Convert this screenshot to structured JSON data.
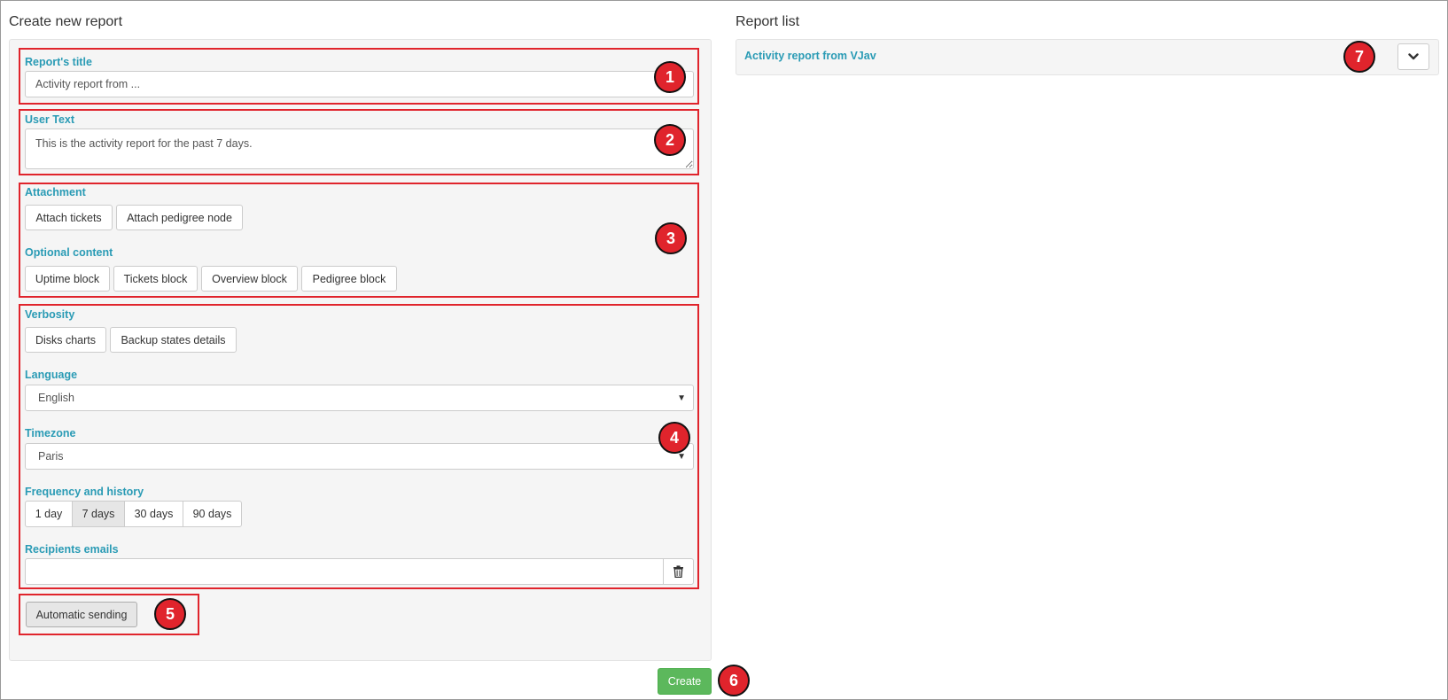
{
  "left_panel": {
    "heading": "Create new report",
    "report_title": {
      "label": "Report's title",
      "value": "Activity report from ..."
    },
    "user_text": {
      "label": "User Text",
      "value": "This is the activity report for the past 7 days."
    },
    "attachment": {
      "label": "Attachment",
      "buttons": [
        "Attach tickets",
        "Attach pedigree node"
      ]
    },
    "optional_content": {
      "label": "Optional content",
      "buttons": [
        "Uptime block",
        "Tickets block",
        "Overview block",
        "Pedigree block"
      ]
    },
    "verbosity": {
      "label": "Verbosity",
      "buttons": [
        "Disks charts",
        "Backup states details"
      ]
    },
    "language": {
      "label": "Language",
      "selected": "English"
    },
    "timezone": {
      "label": "Timezone",
      "selected": "Paris"
    },
    "frequency": {
      "label": "Frequency and history",
      "options": [
        "1 day",
        "7 days",
        "30 days",
        "90 days"
      ],
      "active": "7 days"
    },
    "recipients": {
      "label": "Recipients emails",
      "value": ""
    },
    "automatic_sending": {
      "label": "Automatic sending"
    }
  },
  "create_button": {
    "label": "Create"
  },
  "right_panel": {
    "heading": "Report list",
    "items": [
      {
        "title": "Activity report from VJav"
      }
    ]
  },
  "badges": [
    "1",
    "2",
    "3",
    "4",
    "5",
    "6",
    "7"
  ],
  "colors": {
    "label": "#2a9bb5",
    "highlight": "#e0242c",
    "create": "#5cb85c"
  },
  "icons": {
    "caret": "caret-down-icon",
    "trash": "trash-icon",
    "chevron": "chevron-down-icon"
  }
}
